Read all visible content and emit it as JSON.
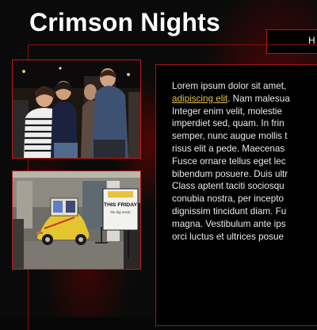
{
  "header": {
    "title": "Crimson Nights",
    "nav_item": "H"
  },
  "photos": [
    {
      "alt": "Three people posing together at a night event"
    },
    {
      "alt": "Decorated yellow car with a THIS FRIDAY sign in a lobby"
    }
  ],
  "photo2_sign": {
    "line1": "THIS FRIDAY",
    "line2": "the big event"
  },
  "article": {
    "lines": [
      "Lorem ipsum dolor sit amet,",
      "",
      "Integer enim velit, molestie",
      "imperdiet sed, quam. In frin",
      "semper, nunc augue mollis t",
      "risus elit a pede. Maecenas",
      "Fusce ornare tellus eget lec",
      "bibendum posuere. Duis ultr",
      "Class aptent taciti sociosqu",
      "conubia nostra, per incepto",
      "dignissim tincidunt diam. Fu",
      "magna. Vestibulum ante ips",
      "orci luctus et ultrices posue"
    ],
    "link_text": "adipiscing elit",
    "after_link": ". Nam malesua"
  },
  "colors": {
    "accent": "#c01a1a",
    "link": "#e2c14a",
    "background": "#070707"
  }
}
